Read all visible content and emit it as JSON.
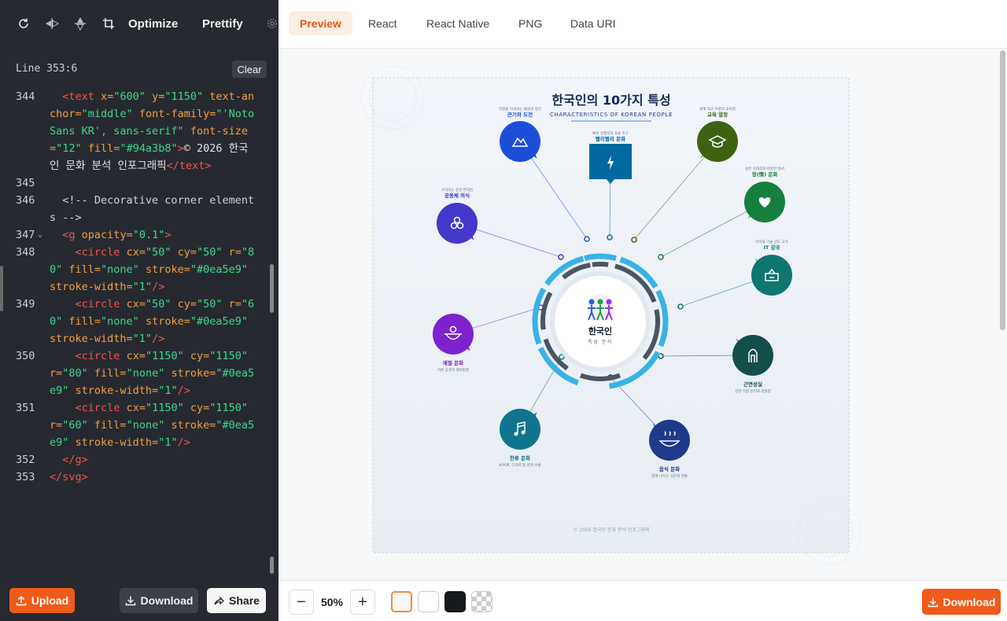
{
  "toolbar": {
    "icons": [
      "refresh-icon",
      "flip-horizontal-icon",
      "flip-vertical-icon",
      "crop-icon",
      "gear-icon"
    ],
    "optimize_label": "Optimize",
    "prettify_label": "Prettify"
  },
  "editor": {
    "status": "Line 353:6",
    "clear_label": "Clear",
    "lines": [
      {
        "n": "344",
        "html": "  <span class='tag'>&lt;text</span> <span class='attr'>x=</span><span class='str'>\"600\"</span> <span class='attr'>y=</span><span class='str'>\"1150\"</span> <span class='attr'>text-anchor=</span><span class='str'>\"middle\"</span> <span class='attr'>font-family=</span><span class='str'>\"'Noto Sans KR', sans-serif\"</span> <span class='attr'>font-size=</span><span class='str'>\"12\"</span> <span class='attr'>fill=</span><span class='str'>\"#94a3b8\"</span><span class='tag'>&gt;</span><span class='txt'>© 2026 한국인 문화 분석 인포그래픽</span><span class='tag'>&lt;/text&gt;</span>"
      },
      {
        "n": "345",
        "html": ""
      },
      {
        "n": "346",
        "html": "  <span class='cmt'>&lt;!-- Decorative corner elements --&gt;</span>"
      },
      {
        "n": "347",
        "fold": true,
        "html": "  <span class='tag'>&lt;g</span> <span class='attr'>opacity=</span><span class='str'>\"0.1\"</span><span class='tag'>&gt;</span>"
      },
      {
        "n": "348",
        "html": "    <span class='tag'>&lt;circle</span> <span class='attr'>cx=</span><span class='str'>\"50\"</span> <span class='attr'>cy=</span><span class='str'>\"50\"</span> <span class='attr'>r=</span><span class='str'>\"80\"</span> <span class='attr'>fill=</span><span class='str'>\"none\"</span> <span class='attr'>stroke=</span><span class='str'>\"#0ea5e9\"</span> <span class='attr'>stroke-width=</span><span class='str'>\"1\"</span><span class='tag'>/&gt;</span>"
      },
      {
        "n": "349",
        "html": "    <span class='tag'>&lt;circle</span> <span class='attr'>cx=</span><span class='str'>\"50\"</span> <span class='attr'>cy=</span><span class='str'>\"50\"</span> <span class='attr'>r=</span><span class='str'>\"60\"</span> <span class='attr'>fill=</span><span class='str'>\"none\"</span> <span class='attr'>stroke=</span><span class='str'>\"#0ea5e9\"</span> <span class='attr'>stroke-width=</span><span class='str'>\"1\"</span><span class='tag'>/&gt;</span>"
      },
      {
        "n": "350",
        "html": "    <span class='tag'>&lt;circle</span> <span class='attr'>cx=</span><span class='str'>\"1150\"</span> <span class='attr'>cy=</span><span class='str'>\"1150\"</span> <span class='attr'>r=</span><span class='str'>\"80\"</span> <span class='attr'>fill=</span><span class='str'>\"none\"</span> <span class='attr'>stroke=</span><span class='str'>\"#0ea5e9\"</span> <span class='attr'>stroke-width=</span><span class='str'>\"1\"</span><span class='tag'>/&gt;</span>"
      },
      {
        "n": "351",
        "html": "    <span class='tag'>&lt;circle</span> <span class='attr'>cx=</span><span class='str'>\"1150\"</span> <span class='attr'>cy=</span><span class='str'>\"1150\"</span> <span class='attr'>r=</span><span class='str'>\"60\"</span> <span class='attr'>fill=</span><span class='str'>\"none\"</span> <span class='attr'>stroke=</span><span class='str'>\"#0ea5e9\"</span> <span class='attr'>stroke-width=</span><span class='str'>\"1\"</span><span class='tag'>/&gt;</span>"
      },
      {
        "n": "352",
        "html": "  <span class='tag'>&lt;/g&gt;</span>"
      },
      {
        "n": "353",
        "html": "<span class='tag'>&lt;/svg&gt;</span>"
      }
    ]
  },
  "left_bottom": {
    "upload_label": "Upload",
    "download_label": "Download",
    "share_label": "Share"
  },
  "tabs": [
    {
      "label": "Preview",
      "active": true
    },
    {
      "label": "React",
      "active": false
    },
    {
      "label": "React Native",
      "active": false
    },
    {
      "label": "PNG",
      "active": false
    },
    {
      "label": "Data URI",
      "active": false
    }
  ],
  "footer": {
    "zoom": "50%",
    "download_label": "Download"
  },
  "infographic": {
    "title": "한국인의 10가지 특성",
    "subtitle": "CHARACTERISTICS OF KOREAN PEOPLE",
    "center_title": "한국인",
    "center_sub": "특성 분석",
    "copyright": "© 2026 한국인 문화 분석 인포그래픽",
    "nodes": [
      {
        "name": "끈기와 도전",
        "desc": "역경을 이겨내는 불굴의 정신"
      },
      {
        "name": "빨리빨리 문화",
        "desc": "빠른 실행력과 효율 추구"
      },
      {
        "name": "교육 열정",
        "desc": "세계 최고 수준의 교육열"
      },
      {
        "name": "정(情) 문화",
        "desc": "깊은 유대감과 따뜻한 정서"
      },
      {
        "name": "IT 강국",
        "desc": "디지털 기술 선도 국가"
      },
      {
        "name": "근면성실",
        "desc": "강한 직업 윤리와 성실함"
      },
      {
        "name": "음식 문화",
        "desc": "함께 나누는 식문화 전통"
      },
      {
        "name": "한류 문화",
        "desc": "K-POP, 드라마 등 문화 수출"
      },
      {
        "name": "예절 문화",
        "desc": "어른 공경과 예의범절"
      },
      {
        "name": "공동체 의식",
        "desc": "우리라는 강한 연대감"
      }
    ]
  },
  "colors": {
    "accent": "#f05a1a",
    "editor_bg": "#262a30",
    "tab_active_bg": "#fdeee3"
  }
}
